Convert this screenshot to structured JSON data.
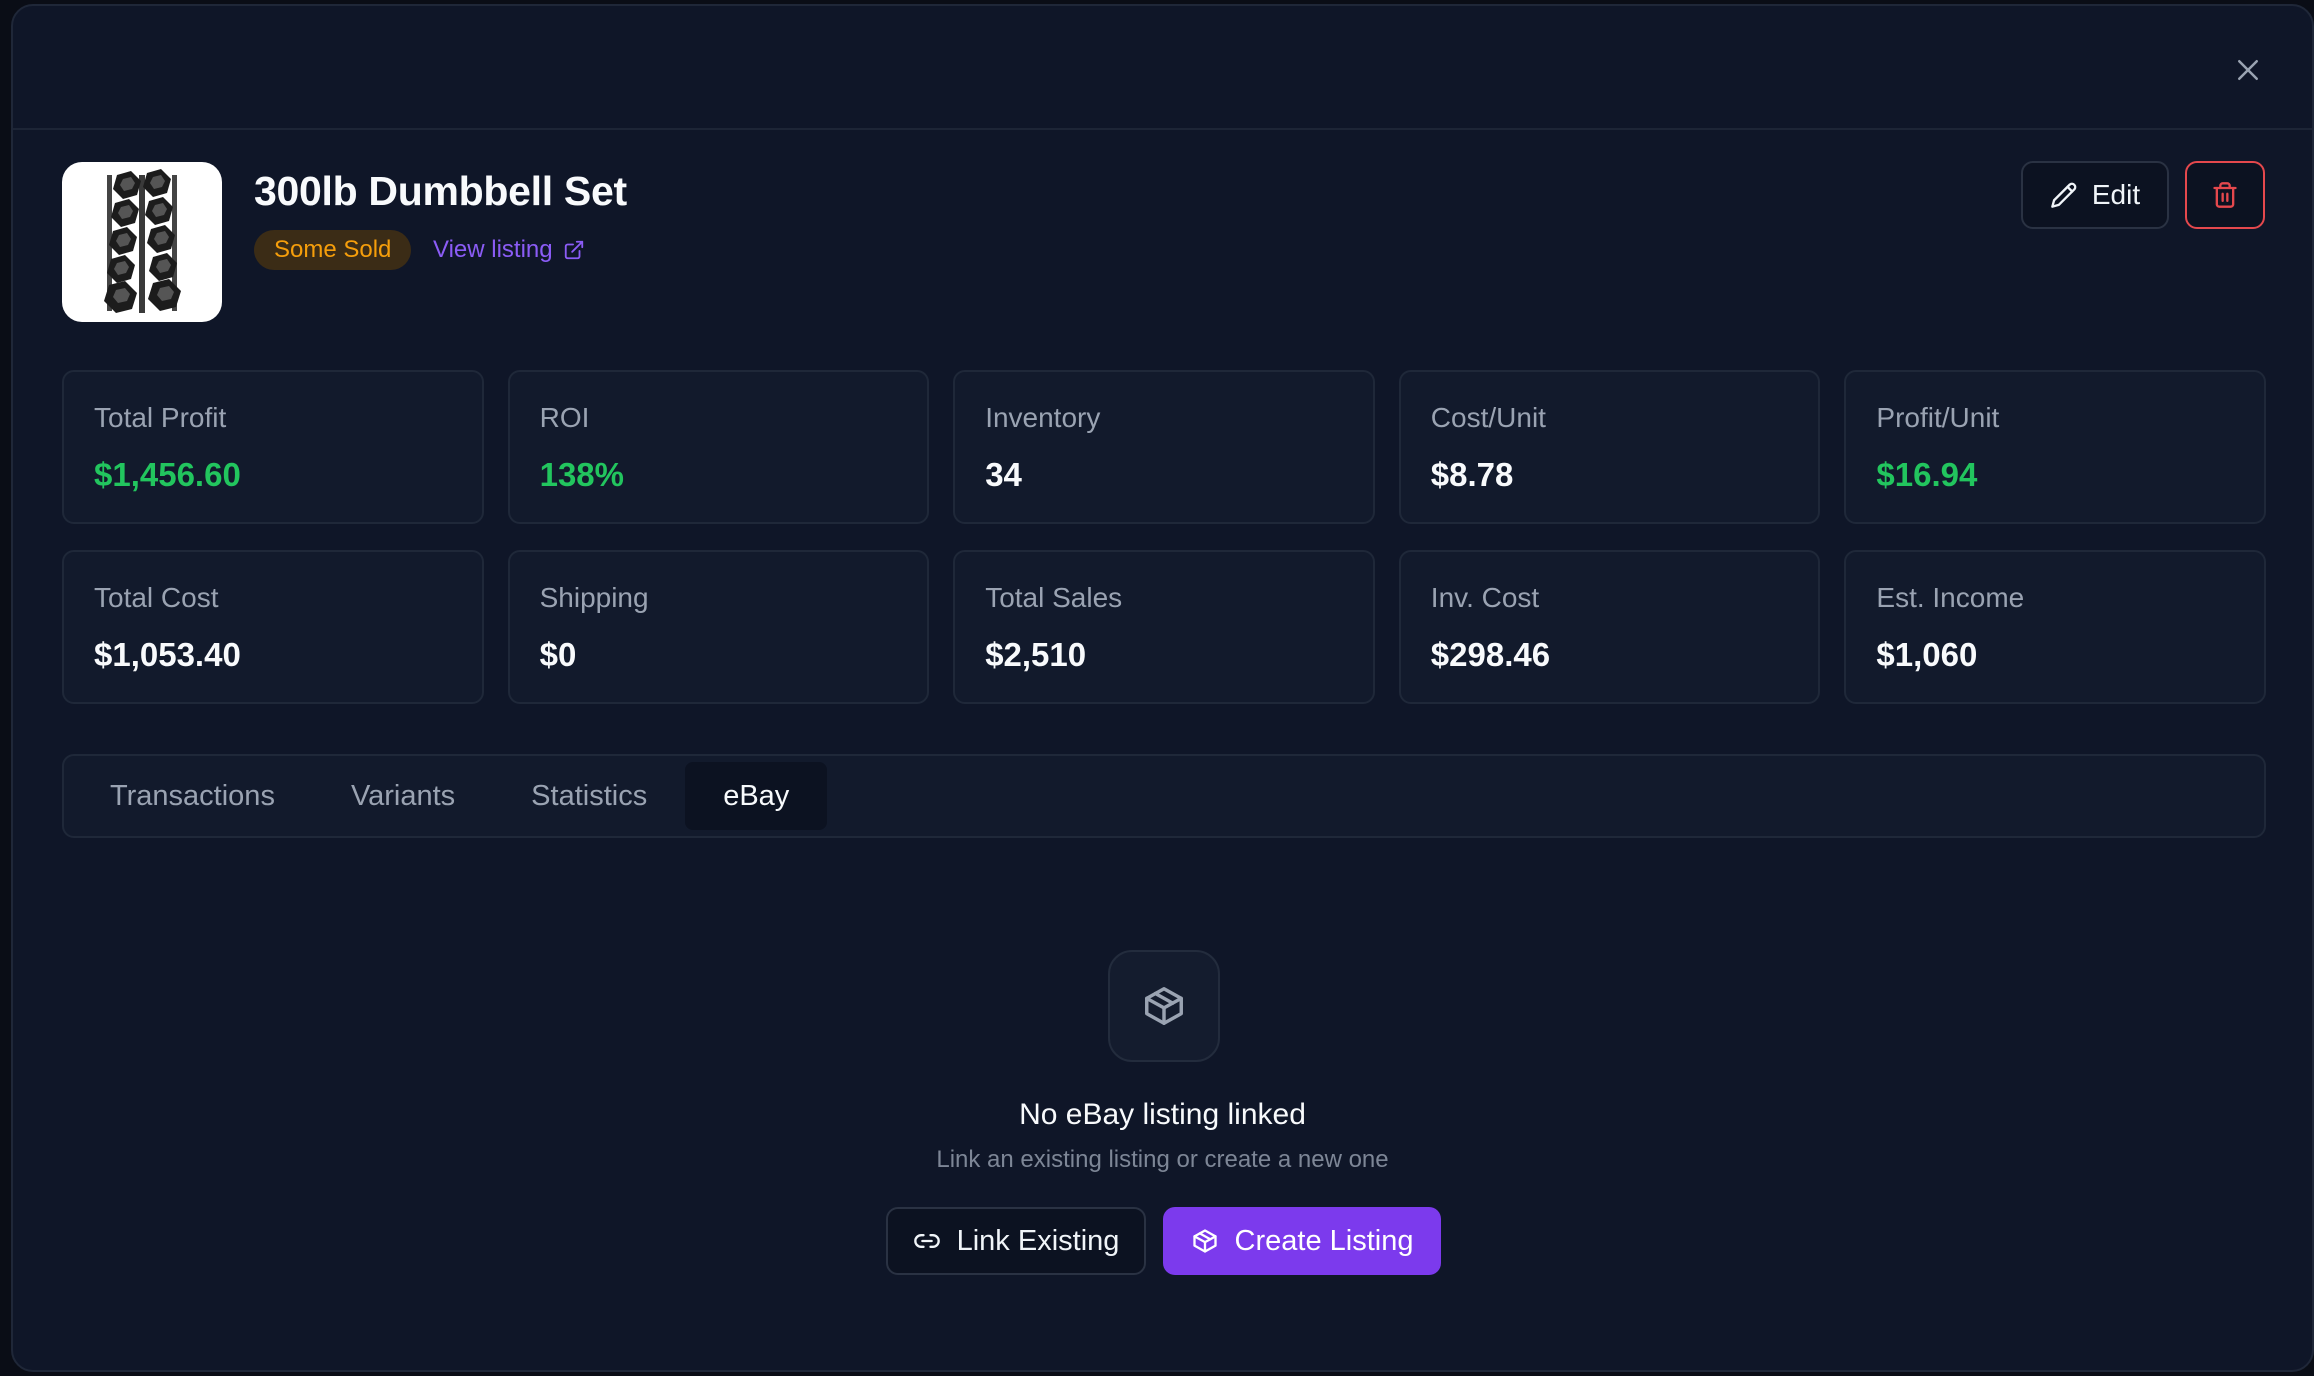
{
  "product": {
    "title": "300lb Dumbbell Set",
    "status_badge": "Some Sold",
    "view_listing_label": "View listing",
    "image_icon": "dumbbell-rack-image"
  },
  "actions": {
    "edit_label": "Edit",
    "delete_icon": "trash-icon",
    "close_icon": "close-icon"
  },
  "stats": [
    {
      "label": "Total Profit",
      "value": "$1,456.60",
      "positive": true
    },
    {
      "label": "ROI",
      "value": "138%",
      "positive": true
    },
    {
      "label": "Inventory",
      "value": "34",
      "positive": false
    },
    {
      "label": "Cost/Unit",
      "value": "$8.78",
      "positive": false
    },
    {
      "label": "Profit/Unit",
      "value": "$16.94",
      "positive": true
    },
    {
      "label": "Total Cost",
      "value": "$1,053.40",
      "positive": false
    },
    {
      "label": "Shipping",
      "value": "$0",
      "positive": false
    },
    {
      "label": "Total Sales",
      "value": "$2,510",
      "positive": false
    },
    {
      "label": "Inv. Cost",
      "value": "$298.46",
      "positive": false
    },
    {
      "label": "Est. Income",
      "value": "$1,060",
      "positive": false
    }
  ],
  "tabs": [
    {
      "label": "Transactions",
      "active": false
    },
    {
      "label": "Variants",
      "active": false
    },
    {
      "label": "Statistics",
      "active": false
    },
    {
      "label": "eBay",
      "active": true
    }
  ],
  "ebay": {
    "empty_title": "No eBay listing linked",
    "empty_subtitle": "Link an existing listing or create a new one",
    "link_existing_label": "Link Existing",
    "create_listing_label": "Create Listing"
  },
  "colors": {
    "accent": "#7c3aed",
    "positive": "#22c55e",
    "badge_text": "#f59e0b",
    "danger": "#e5484d",
    "background": "#0f1628"
  }
}
